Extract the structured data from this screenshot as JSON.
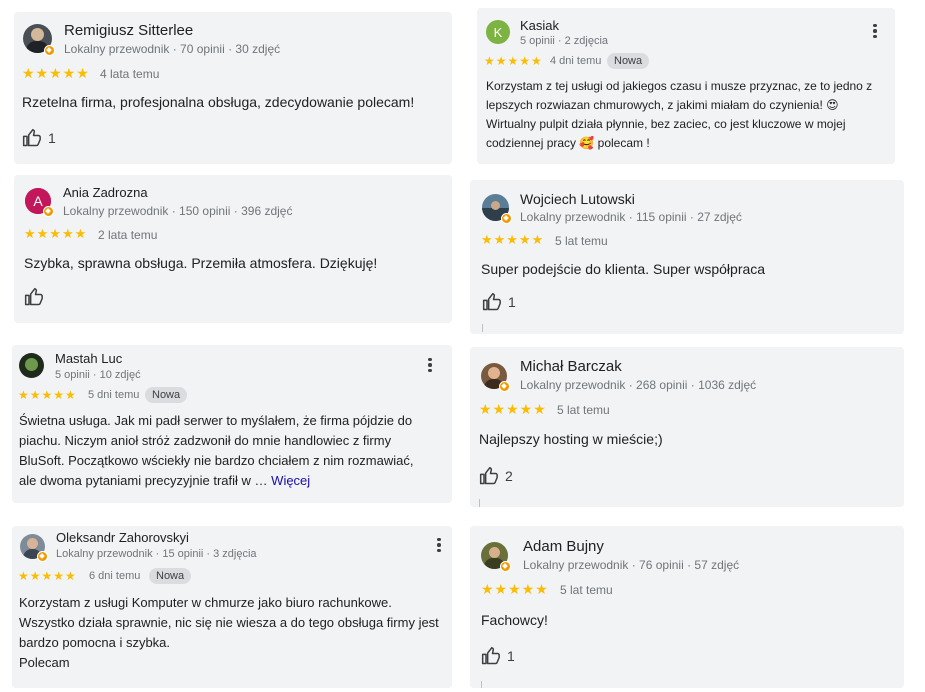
{
  "colors": {
    "star": "#fbbc04",
    "card_bg": "#f1f3f4",
    "link": "#1a0dab",
    "guide_badge": "#f29900"
  },
  "icons": {
    "like": "thumb-up-icon",
    "more": "more-vert-icon",
    "star": "star-icon",
    "guide": "local-guide-badge-icon"
  },
  "reviews": [
    {
      "name": "Remigiusz Sitterlee",
      "meta": "Lokalny przewodnik · 70 opinii · 30 zdjęć",
      "rating": 5,
      "stars": "★★★★★",
      "when": "4 lata temu",
      "text": "Rzetelna firma, profesjonalna obsługa, zdecydowanie polecam!",
      "likes": "1"
    },
    {
      "name": "Kasiak",
      "avatar_letter": "K",
      "meta": "5 opinii · 2 zdjęcia",
      "rating": 5,
      "stars": "★★★★★",
      "when": "4 dni temu",
      "badge": "Nowa",
      "text": "Korzystam z tej usługi od jakiegos czasu i musze przyznac, ze to jedno z lepszych rozwiazan chmurowych, z jakimi miałam do czynienia! 😍 Wirtualny pulpit działa płynnie, bez zaciec, co jest kluczowe w mojej codziennej pracy 🥰 polecam !"
    },
    {
      "name": "Ania Zadrozna",
      "avatar_letter": "A",
      "meta": "Lokalny przewodnik · 150 opinii · 396 zdjęć",
      "rating": 5,
      "stars": "★★★★★",
      "when": "2 lata temu",
      "text": "Szybka, sprawna obsługa. Przemiła atmosfera. Dziękuję!"
    },
    {
      "name": "Wojciech Lutowski",
      "meta": "Lokalny przewodnik · 115 opinii · 27 zdjęć",
      "rating": 5,
      "stars": "★★★★★",
      "when": "5 lat temu",
      "text": "Super podejście do klienta. Super współpraca",
      "likes": "1"
    },
    {
      "name": "Mastah Luc",
      "meta": "5 opinii · 10 zdjęć",
      "rating": 5,
      "stars": "★★★★★",
      "when": "5 dni temu",
      "badge": "Nowa",
      "text": "Świetna usługa. Jak mi padł serwer to myślałem, że firma pójdzie do piachu. Niczym anioł stróż zadzwonił do mnie handlowiec z firmy BluSoft. Początkowo wściekły nie bardzo chciałem z nim rozmawiać, ale dwoma pytaniami precyzyjnie trafił w …",
      "more_link": "Więcej"
    },
    {
      "name": "Michał Barczak",
      "meta": "Lokalny przewodnik · 268 opinii · 1036 zdjęć",
      "rating": 5,
      "stars": "★★★★★",
      "when": "5 lat temu",
      "text": "Najlepszy hosting w mieście;)",
      "likes": "2"
    },
    {
      "name": "Oleksandr Zahorovskyi",
      "meta": "Lokalny przewodnik · 15 opinii · 3 zdjęcia",
      "rating": 5,
      "stars": "★★★★★",
      "when": "6 dni temu",
      "badge": "Nowa",
      "text": "Korzystam z usługi Komputer w chmurze jako biuro rachunkowe. Wszystko działa sprawnie, nic się nie wiesza a do tego obsługa firmy jest bardzo pomocna i szybka.\nPolecam"
    },
    {
      "name": "Adam Bujny",
      "meta": "Lokalny przewodnik · 76 opinii · 57 zdjęć",
      "rating": 5,
      "stars": "★★★★★",
      "when": "5 lat temu",
      "text": "Fachowcy!",
      "likes": "1"
    }
  ]
}
